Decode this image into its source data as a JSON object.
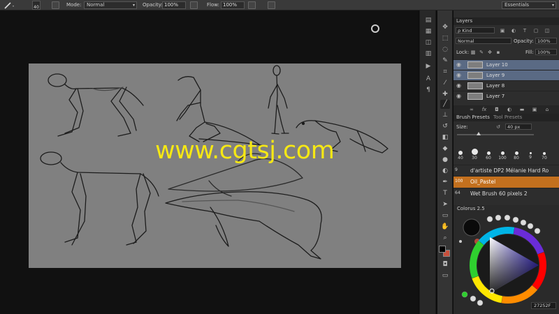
{
  "options_bar": {
    "brush_size": "40",
    "mode_label": "Mode:",
    "mode_value": "Normal",
    "opacity_label": "Opacity:",
    "opacity_value": "100%",
    "flow_label": "Flow:",
    "flow_value": "100%",
    "workspace_value": "Essentials",
    "icons": [
      "brush-icon",
      "toggle-brush-panel-icon",
      "airbrush-icon",
      "pressure-icon"
    ]
  },
  "watermark": "www.cgtsj.com",
  "layers_panel": {
    "tab": "Layers",
    "filter_value": "ρ Kind",
    "blend_mode": "Normal",
    "opacity_label": "Opacity:",
    "opacity_value": "100%",
    "lock_label": "Lock:",
    "fill_label": "Fill:",
    "fill_value": "100%",
    "layers": [
      {
        "name": "Layer 10",
        "selected": true
      },
      {
        "name": "Layer 9",
        "selected": true
      },
      {
        "name": "Layer 8",
        "selected": false
      },
      {
        "name": "Layer 7",
        "selected": false
      }
    ],
    "footer_icons": [
      "link-icon",
      "fx-icon",
      "mask-icon",
      "adjustment-icon",
      "group-icon",
      "new-layer-icon",
      "trash-icon"
    ]
  },
  "brush_presets": {
    "tab_active": "Brush Presets",
    "tab_inactive": "Tool Presets",
    "size_label": "Size:",
    "size_value": "40 px",
    "tips": [
      "40",
      "30",
      "60",
      "100",
      "80",
      "9",
      "70"
    ],
    "presets": [
      {
        "thumb_num": "9",
        "name": "d'artiste DP2 Mélanie Hard Ro",
        "selected": false
      },
      {
        "thumb_num": "100",
        "name": "Oil_Pastel",
        "selected": true
      },
      {
        "thumb_num": "64",
        "name": "Wet Brush 60 pixels 2",
        "selected": false
      }
    ]
  },
  "colorus": {
    "title": "Colorus 2.5",
    "hex_value": "27252F"
  },
  "colors": {
    "foreground": "#000000",
    "background": "#c8503c",
    "selected_layer": "#5a6a84",
    "selected_preset": "#c3701e",
    "watermark": "#f6e814",
    "canvas": "#808080"
  }
}
